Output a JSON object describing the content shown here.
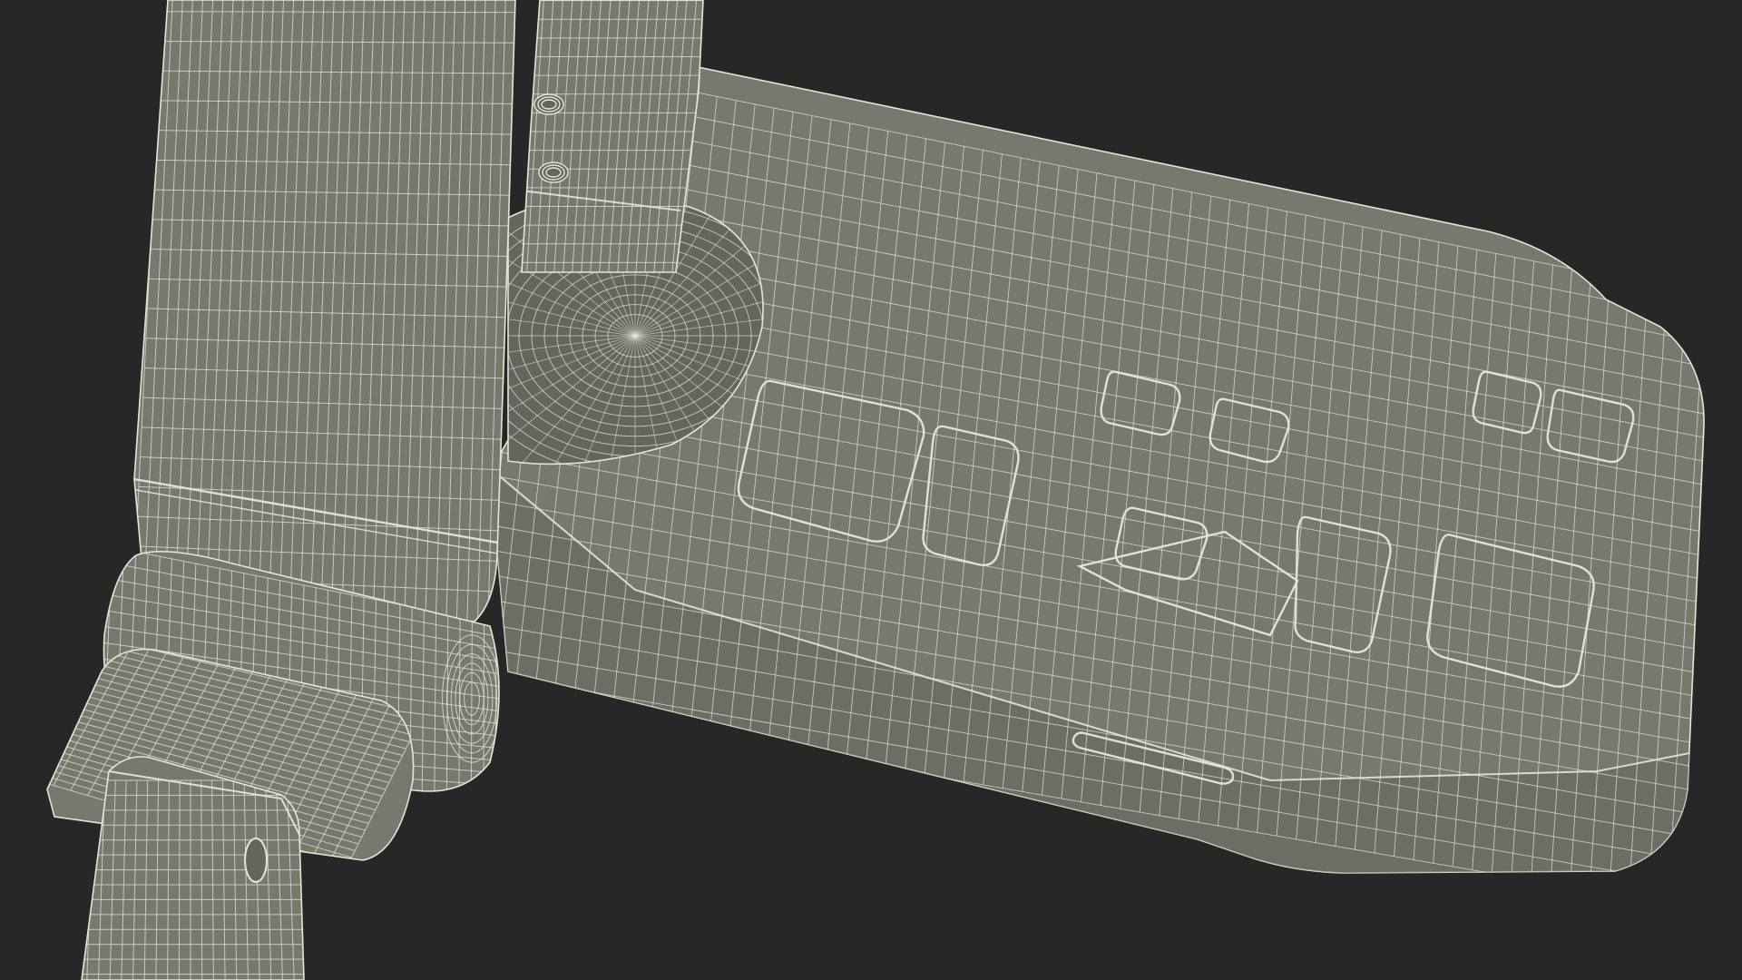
{
  "scene": {
    "background_color": "#272727",
    "surface_color": "#77786e",
    "surface_shadow_color": "#64655c",
    "surface_highlight_color": "#85867b",
    "wire_color": "#e4e6d6",
    "render_mode": "wireframe-on-shaded"
  }
}
